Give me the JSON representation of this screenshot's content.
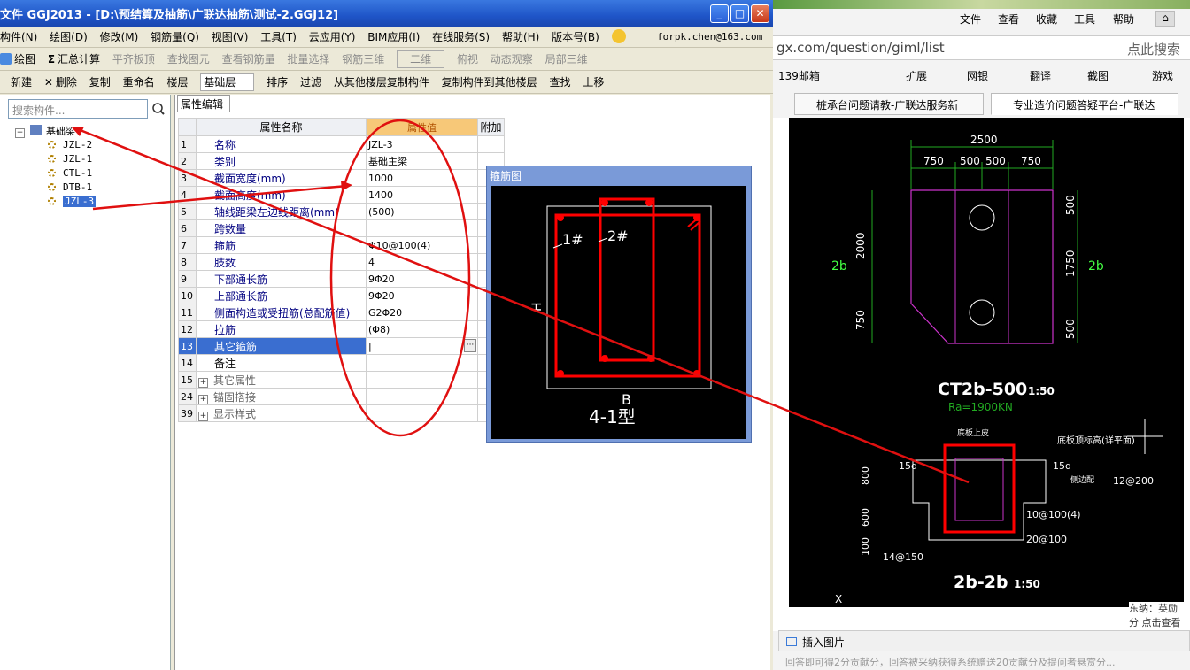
{
  "app": {
    "title": "文件 GGJ2013 - [D:\\预结算及抽筋\\广联达抽筋\\测试-2.GGJ12]",
    "menu": [
      "构件(N)",
      "绘图(D)",
      "修改(M)",
      "钢筋量(Q)",
      "视图(V)",
      "工具(T)",
      "云应用(Y)",
      "BIM应用(I)",
      "在线服务(S)",
      "帮助(H)",
      "版本号(B)"
    ],
    "user": "forpk.chen@163.com",
    "toolbar1": [
      "绘图",
      "汇总计算",
      "平齐板顶",
      "查找图元",
      "查看钢筋量",
      "批量选择",
      "钢筋三维",
      "二维",
      "俯视",
      "动态观察",
      "局部三维"
    ],
    "toolbar2": [
      "新建",
      "删除",
      "复制",
      "重命名",
      "楼层",
      "基础层",
      "排序",
      "过滤",
      "从其他楼层复制构件",
      "复制构件到其他楼层",
      "查找",
      "上移"
    ]
  },
  "tree": {
    "search_placeholder": "搜索构件...",
    "root": "基础梁",
    "items": [
      "JZL-2",
      "JZL-1",
      "CTL-1",
      "DTB-1",
      "JZL-3"
    ],
    "selected": "JZL-3"
  },
  "props": {
    "tab": "属性编辑",
    "headers": [
      "属性名称",
      "属性值",
      "附加"
    ],
    "rows": [
      {
        "num": "1",
        "name": "名称",
        "value": "JZL-3"
      },
      {
        "num": "2",
        "name": "类别",
        "value": "基础主梁"
      },
      {
        "num": "3",
        "name": "截面宽度(mm)",
        "value": "1000"
      },
      {
        "num": "4",
        "name": "截面高度(mm)",
        "value": "1400"
      },
      {
        "num": "5",
        "name": "轴线距梁左边线距离(mm)",
        "value": "(500)"
      },
      {
        "num": "6",
        "name": "跨数量",
        "value": ""
      },
      {
        "num": "7",
        "name": "箍筋",
        "value": "Φ10@100(4)"
      },
      {
        "num": "8",
        "name": "肢数",
        "value": "4"
      },
      {
        "num": "9",
        "name": "下部通长筋",
        "value": "9Φ20"
      },
      {
        "num": "10",
        "name": "上部通长筋",
        "value": "9Φ20"
      },
      {
        "num": "11",
        "name": "侧面构造或受扭筋(总配筋值)",
        "value": "G2Φ20"
      },
      {
        "num": "12",
        "name": "拉筋",
        "value": "(Φ8)"
      },
      {
        "num": "13",
        "name": "其它箍筋",
        "value": "|"
      },
      {
        "num": "14",
        "name": "备注",
        "value": ""
      },
      {
        "num": "15",
        "name": "其它属性",
        "value": ""
      },
      {
        "num": "24",
        "name": "锚固搭接",
        "value": ""
      },
      {
        "num": "39",
        "name": "显示样式",
        "value": ""
      }
    ]
  },
  "stirrup": {
    "title": "箍筋图",
    "label1": "1#",
    "label2": "2#",
    "dimH": "H",
    "dimB": "B",
    "type": "4-1型"
  },
  "browser": {
    "menu": [
      "文件",
      "查看",
      "收藏",
      "工具",
      "帮助"
    ],
    "url": "gx.com/question/giml/list",
    "search_hint": "点此搜索",
    "fav": [
      "139邮箱",
      "扩展",
      "网银",
      "翻译",
      "截图",
      "游戏"
    ],
    "tabs": [
      "桩承台问题请教-广联达服务新",
      "专业造价问题答疑平台-广联达"
    ],
    "insert_label": "插入图片",
    "hint": "回答即可得2分贡献分，回答被采纳获得系统赠送20贡献分及提问者悬赏分...",
    "side_text": "东纳：英励 分 点击查看"
  },
  "cad": {
    "dims_top": [
      "2500",
      "750",
      "500",
      "500",
      "750"
    ],
    "dims_left": [
      "2000",
      "750"
    ],
    "dims_right": [
      "500",
      "1750",
      "500"
    ],
    "label_2b": "2b",
    "title1": "CT2b-500",
    "scale1": "1:50",
    "ra": "Ra=1900KN",
    "title2": "2b-2b",
    "scale2": "1:50",
    "note_top": "底板顶标高(详平面)",
    "note_bot": "底板上皮",
    "rebar": [
      "15d",
      "15d",
      "12@200",
      "10@100(4)",
      "20@100",
      "14@150"
    ],
    "side_dims": [
      "800",
      "600",
      "100"
    ],
    "side_label": "侧边配"
  }
}
